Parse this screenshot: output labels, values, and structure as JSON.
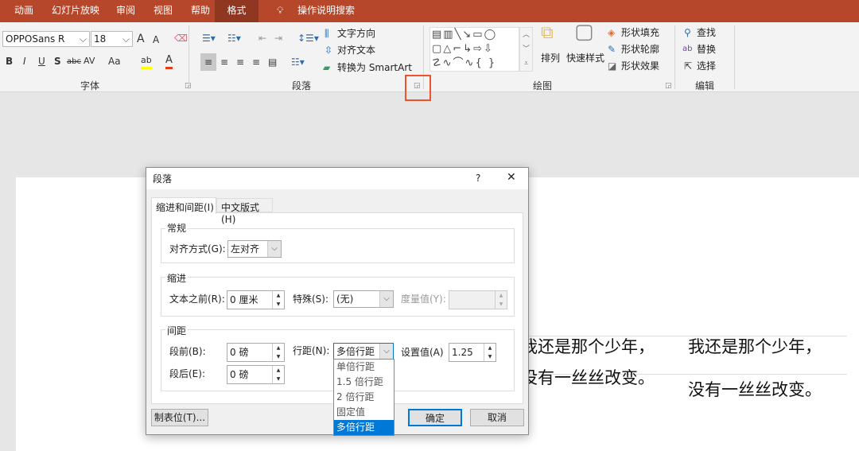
{
  "tabs": [
    "动画",
    "幻灯片放映",
    "审阅",
    "视图",
    "帮助",
    "格式"
  ],
  "active_tab": "格式",
  "tell_me": "操作说明搜索",
  "font": {
    "name": "OPPOSans R",
    "size": "18",
    "group_label": "字体",
    "bold": "B",
    "italic": "I",
    "underline": "U",
    "shadow": "S",
    "strike": "abc",
    "spacing": "AV",
    "case": "Aa",
    "grow": "A",
    "shrink": "A",
    "highlight": "ab",
    "color": "A"
  },
  "paragraph": {
    "group_label": "段落",
    "text_direction": "文字方向",
    "align_text": "对齐文本",
    "smartart": "转换为 SmartArt"
  },
  "drawing": {
    "group_label": "绘图",
    "arrange": "排列",
    "quick_styles": "快速样式",
    "fill": "形状填充",
    "outline": "形状轮廓",
    "effects": "形状效果"
  },
  "editing": {
    "group_label": "编辑",
    "find": "查找",
    "replace": "替换",
    "select": "选择"
  },
  "slide": {
    "line1": "我还是那个少年，",
    "line2": "没有一丝丝改变。"
  },
  "dialog": {
    "title": "段落",
    "help": "?",
    "close": "✕",
    "tabs": [
      "缩进和间距(I)",
      "中文版式(H)"
    ],
    "general": {
      "legend": "常规",
      "align_label": "对齐方式(G):",
      "align_value": "左对齐"
    },
    "indent": {
      "legend": "缩进",
      "before_label": "文本之前(R):",
      "before_value": "0 厘米",
      "special_label": "特殊(S):",
      "special_value": "(无)",
      "by_label": "度量值(Y):",
      "by_value": ""
    },
    "spacing": {
      "legend": "间距",
      "before_label": "段前(B):",
      "before_value": "0 磅",
      "after_label": "段后(E):",
      "after_value": "0 磅",
      "line_label": "行距(N):",
      "line_value": "多倍行距",
      "at_label": "设置值(A)",
      "at_value": "1.25"
    },
    "line_options": [
      "单倍行距",
      "1.5 倍行距",
      "2 倍行距",
      "固定值",
      "多倍行距"
    ],
    "tabs_button": "制表位(T)...",
    "ok": "确定",
    "cancel": "取消"
  },
  "colors": {
    "accent": "#B7472A",
    "highlight_box": "#F0522D",
    "selection": "#0078D7"
  }
}
